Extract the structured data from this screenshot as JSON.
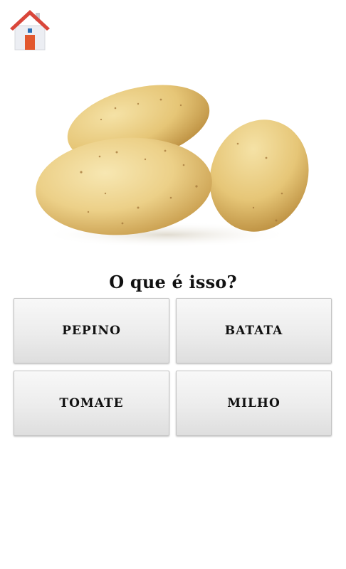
{
  "home": {
    "icon": "home-icon"
  },
  "picture": {
    "subject": "potatoes-image"
  },
  "question": "O que é isso?",
  "answers": [
    {
      "label": "PEPINO"
    },
    {
      "label": "BATATA"
    },
    {
      "label": "TOMATE"
    },
    {
      "label": "MILHO"
    }
  ],
  "colors": {
    "roof": "#d9463a",
    "wall": "#eceef3",
    "door": "#e2582e",
    "window": "#2b6fb5",
    "potato_skin": "#e8c878",
    "potato_highlight": "#f6e3a8",
    "button_face": "#ececec",
    "button_border": "#c4c4c4"
  }
}
